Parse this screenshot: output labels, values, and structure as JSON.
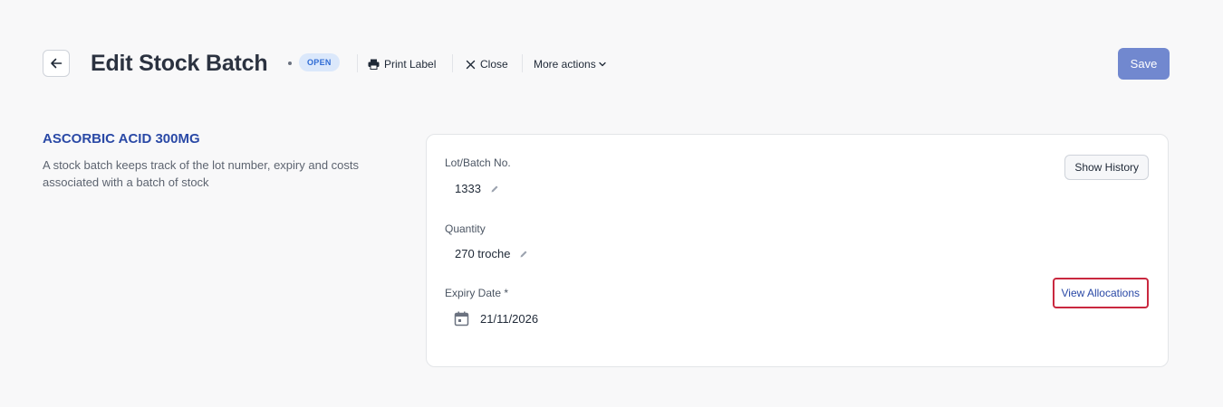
{
  "header": {
    "title": "Edit Stock Batch",
    "status": "OPEN",
    "print_label": "Print Label",
    "close_label": "Close",
    "more_actions_label": "More actions",
    "save_label": "Save"
  },
  "product": {
    "name": "ASCORBIC ACID 300MG",
    "description": "A stock batch keeps track of the lot number, expiry and costs associated with a batch of stock"
  },
  "form": {
    "lot_label": "Lot/Batch No.",
    "lot_value": "1333",
    "quantity_label": "Quantity",
    "quantity_value": "270 troche",
    "expiry_label": "Expiry Date *",
    "expiry_value": "21/11/2026",
    "show_history_label": "Show History",
    "view_allocations_label": "View Allocations"
  },
  "colors": {
    "primary": "#7188cf",
    "link": "#2a49a6",
    "badge_bg": "#dbe8fb",
    "badge_text": "#2f6cd5",
    "highlight_border": "#c9283f"
  },
  "icons": [
    "arrow-left-icon",
    "printer-icon",
    "close-icon",
    "chevron-down-icon",
    "pencil-icon",
    "calendar-icon"
  ]
}
